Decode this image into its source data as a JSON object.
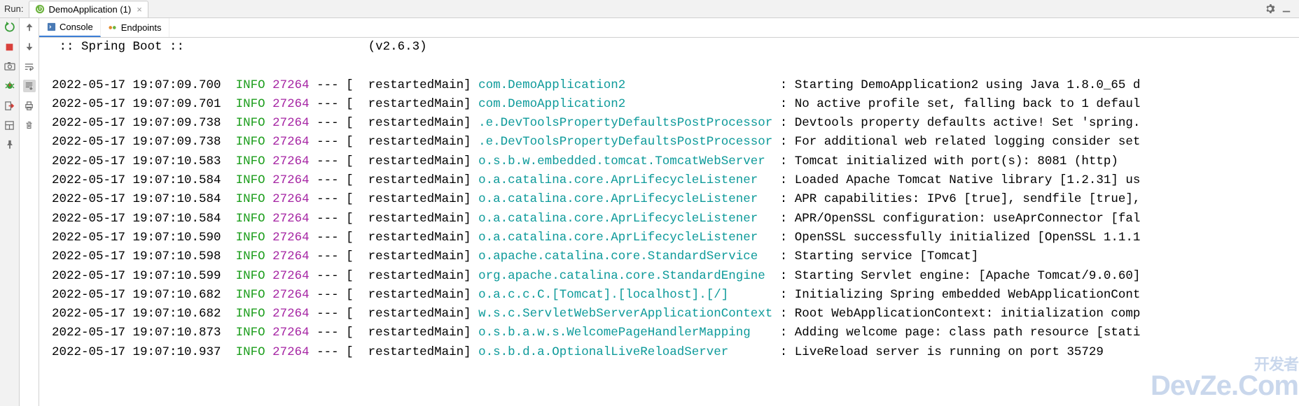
{
  "header": {
    "run_label": "Run:",
    "tab_label": "DemoApplication (1)"
  },
  "sub_tabs": {
    "console": "Console",
    "endpoints": "Endpoints"
  },
  "banner": {
    "left": " :: Spring Boot :: ",
    "right": "(v2.6.3)"
  },
  "log": [
    {
      "ts": "2022-05-17 19:07:09.700",
      "lvl": "INFO",
      "pid": "27264",
      "thread": "restartedMain",
      "logger": "com.DemoApplication2",
      "msg": "Starting DemoApplication2 using Java 1.8.0_65 d"
    },
    {
      "ts": "2022-05-17 19:07:09.701",
      "lvl": "INFO",
      "pid": "27264",
      "thread": "restartedMain",
      "logger": "com.DemoApplication2",
      "msg": "No active profile set, falling back to 1 defaul"
    },
    {
      "ts": "2022-05-17 19:07:09.738",
      "lvl": "INFO",
      "pid": "27264",
      "thread": "restartedMain",
      "logger": ".e.DevToolsPropertyDefaultsPostProcessor",
      "msg": "Devtools property defaults active! Set 'spring."
    },
    {
      "ts": "2022-05-17 19:07:09.738",
      "lvl": "INFO",
      "pid": "27264",
      "thread": "restartedMain",
      "logger": ".e.DevToolsPropertyDefaultsPostProcessor",
      "msg": "For additional web related logging consider set"
    },
    {
      "ts": "2022-05-17 19:07:10.583",
      "lvl": "INFO",
      "pid": "27264",
      "thread": "restartedMain",
      "logger": "o.s.b.w.embedded.tomcat.TomcatWebServer",
      "msg": "Tomcat initialized with port(s): 8081 (http)"
    },
    {
      "ts": "2022-05-17 19:07:10.584",
      "lvl": "INFO",
      "pid": "27264",
      "thread": "restartedMain",
      "logger": "o.a.catalina.core.AprLifecycleListener",
      "msg": "Loaded Apache Tomcat Native library [1.2.31] us"
    },
    {
      "ts": "2022-05-17 19:07:10.584",
      "lvl": "INFO",
      "pid": "27264",
      "thread": "restartedMain",
      "logger": "o.a.catalina.core.AprLifecycleListener",
      "msg": "APR capabilities: IPv6 [true], sendfile [true],"
    },
    {
      "ts": "2022-05-17 19:07:10.584",
      "lvl": "INFO",
      "pid": "27264",
      "thread": "restartedMain",
      "logger": "o.a.catalina.core.AprLifecycleListener",
      "msg": "APR/OpenSSL configuration: useAprConnector [fal"
    },
    {
      "ts": "2022-05-17 19:07:10.590",
      "lvl": "INFO",
      "pid": "27264",
      "thread": "restartedMain",
      "logger": "o.a.catalina.core.AprLifecycleListener",
      "msg": "OpenSSL successfully initialized [OpenSSL 1.1.1"
    },
    {
      "ts": "2022-05-17 19:07:10.598",
      "lvl": "INFO",
      "pid": "27264",
      "thread": "restartedMain",
      "logger": "o.apache.catalina.core.StandardService",
      "msg": "Starting service [Tomcat]"
    },
    {
      "ts": "2022-05-17 19:07:10.599",
      "lvl": "INFO",
      "pid": "27264",
      "thread": "restartedMain",
      "logger": "org.apache.catalina.core.StandardEngine",
      "msg": "Starting Servlet engine: [Apache Tomcat/9.0.60]"
    },
    {
      "ts": "2022-05-17 19:07:10.682",
      "lvl": "INFO",
      "pid": "27264",
      "thread": "restartedMain",
      "logger": "o.a.c.c.C.[Tomcat].[localhost].[/]",
      "msg": "Initializing Spring embedded WebApplicationCont"
    },
    {
      "ts": "2022-05-17 19:07:10.682",
      "lvl": "INFO",
      "pid": "27264",
      "thread": "restartedMain",
      "logger": "w.s.c.ServletWebServerApplicationContext",
      "msg": "Root WebApplicationContext: initialization comp"
    },
    {
      "ts": "2022-05-17 19:07:10.873",
      "lvl": "INFO",
      "pid": "27264",
      "thread": "restartedMain",
      "logger": "o.s.b.a.w.s.WelcomePageHandlerMapping",
      "msg": "Adding welcome page: class path resource [stati"
    },
    {
      "ts": "2022-05-17 19:07:10.937",
      "lvl": "INFO",
      "pid": "27264",
      "thread": "restartedMain",
      "logger": "o.s.b.d.a.OptionalLiveReloadServer",
      "msg": "LiveReload server is running on port 35729"
    }
  ],
  "watermark": {
    "cn": "开发者",
    "en": "DevZe.Com"
  },
  "colors": {
    "info": "#1d9e1d",
    "pid": "#a626a4",
    "logger": "#0d9a9a"
  }
}
